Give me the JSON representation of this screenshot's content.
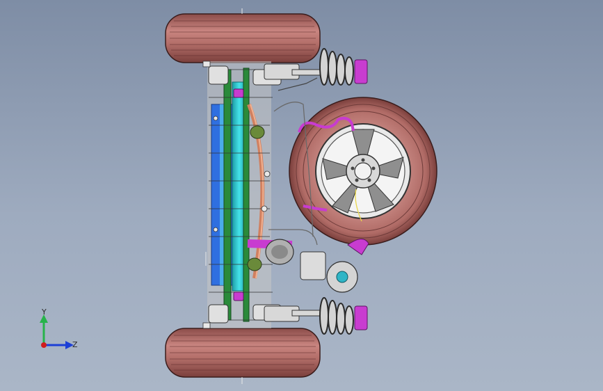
{
  "viewport": {
    "background_top": "#7e8da5",
    "background_bottom": "#aab6c7"
  },
  "model": {
    "tire_color": "#b06b66",
    "tire_shadow": "#6e3b39",
    "frame_cyan": "#33d1d8",
    "frame_blue": "#2f6fe0",
    "frame_green": "#2a8a3a",
    "accent_magenta": "#c83cd0",
    "metal_gray": "#b9b9b9"
  },
  "triad": {
    "y_label": "Y",
    "z_label": "Z",
    "y_color": "#27b34a",
    "z_color": "#1c3fd6",
    "x_color": "#d01d1d"
  }
}
